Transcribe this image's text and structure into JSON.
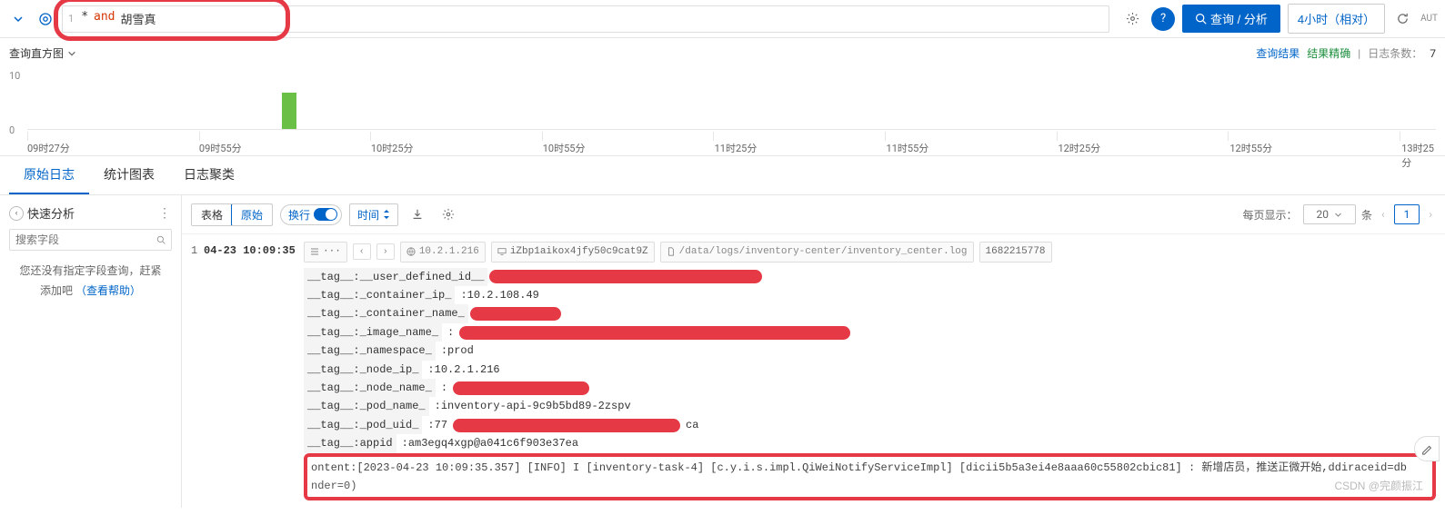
{
  "topbar": {
    "query_line": "1",
    "query_star": "*",
    "query_and": "and",
    "query_term": "胡雪真",
    "search_btn": "查询 / 分析",
    "time_range": "4小时（相对）",
    "auto_label": "AUT"
  },
  "histogram": {
    "title": "查询直方图",
    "right_link": "查询结果",
    "status": "结果精确",
    "count_label": "日志条数：",
    "count_value": "7",
    "y_max": "10",
    "y_min": "0",
    "ticks": [
      "09时27分",
      "09时55分",
      "10时25分",
      "10时55分",
      "11时25分",
      "11时55分",
      "12时25分",
      "12时55分",
      "13时25分"
    ]
  },
  "tabs": {
    "raw": "原始日志",
    "stats": "统计图表",
    "cluster": "日志聚类"
  },
  "sidebar": {
    "title": "快速分析",
    "search_placeholder": "搜索字段",
    "hint1": "您还没有指定字段查询，赶紧",
    "hint2": "添加吧",
    "hint_link": "（查看帮助）"
  },
  "toolbar": {
    "view_table": "表格",
    "view_raw": "原始",
    "wrap": "换行",
    "time": "时间",
    "per_page_label": "每页显示：",
    "per_page_value": "20",
    "per_page_unit": "条",
    "page_num": "1"
  },
  "log": {
    "index": "1",
    "timestamp": "04-23 10:09:35",
    "chip_ip": "10.2.1.216",
    "chip_host": "iZbp1aikox4jfy50c9cat9Z",
    "chip_path": "/data/logs/inventory-center/inventory_center.log",
    "chip_ts": "1682215778",
    "tags": [
      {
        "k": "__tag__:__user_defined_id__",
        "v": "",
        "redact": "lg"
      },
      {
        "k": "__tag__:_container_ip_",
        "v": ":10.2.108.49",
        "redact": ""
      },
      {
        "k": "__tag__:_container_name_",
        "v": "",
        "redact": "sm",
        "suffix": ""
      },
      {
        "k": "__tag__:_image_name_",
        "v": ":",
        "redact": "xl",
        "suffix": ""
      },
      {
        "k": "__tag__:_namespace_",
        "v": ":prod",
        "redact": ""
      },
      {
        "k": "__tag__:_node_ip_",
        "v": ":10.2.1.216",
        "redact": ""
      },
      {
        "k": "__tag__:_node_name_",
        "v": ":",
        "redact": "md",
        "suffix": ""
      },
      {
        "k": "__tag__:_pod_name_",
        "v": ":inventory-api-9c9b5bd89-2zspv",
        "redact": ""
      },
      {
        "k": "__tag__:_pod_uid_",
        "v": ":77",
        "redact": "xxl",
        "suffix": "ca"
      },
      {
        "k": "__tag__:appid",
        "v": ":am3egq4xgp@a041c6f903e37ea",
        "redact": ""
      }
    ],
    "content_text": "ontent:[2023-04-23 10:09:35.357] [INFO] I [inventory-task-4] [c.y.i.s.impl.QiWeiNotifyServiceImpl] [dicii5b5a3ei4e8aaa60c55802cbic81] : 新增店员，推送正微开始,ddiraceid=db",
    "content_suffix": "nder=0)"
  },
  "watermark": "CSDN @完颜振江"
}
